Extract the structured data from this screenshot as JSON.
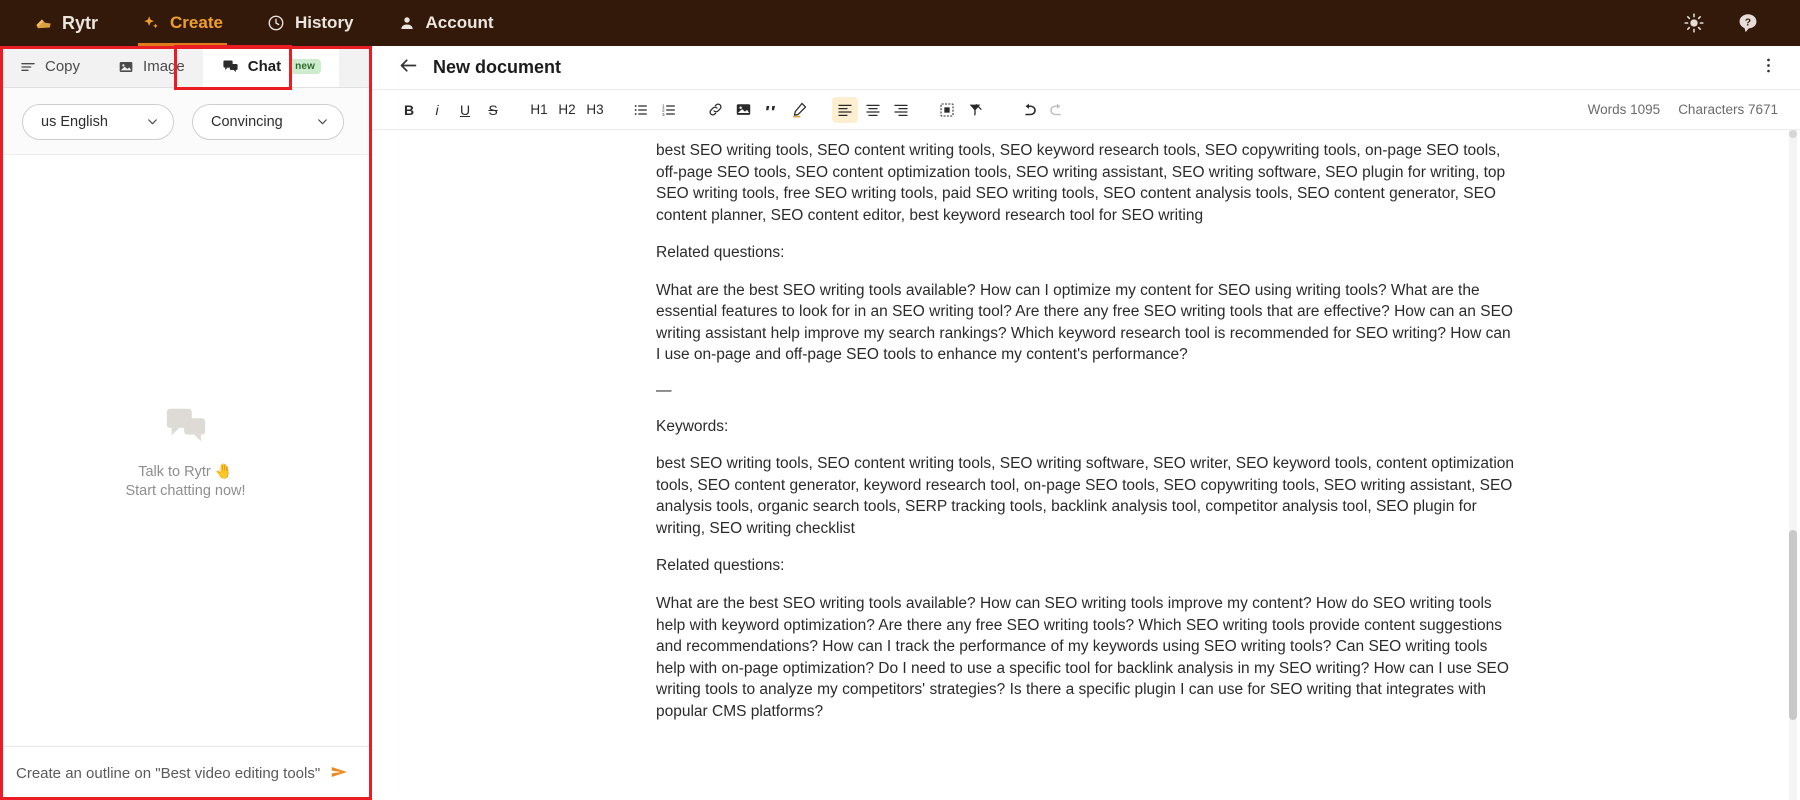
{
  "topnav": {
    "brand": "Rytr",
    "items": [
      {
        "label": "Rytr",
        "icon": "hand-wave-icon",
        "active": false
      },
      {
        "label": "Create",
        "icon": "sparkle-icon",
        "active": true
      },
      {
        "label": "History",
        "icon": "clock-icon",
        "active": false
      },
      {
        "label": "Account",
        "icon": "person-icon",
        "active": false
      }
    ],
    "right": [
      {
        "name": "brightness-icon"
      },
      {
        "name": "help-icon"
      }
    ]
  },
  "left_panel": {
    "tabs": [
      {
        "label": "Copy",
        "icon": "lines-icon",
        "active": false,
        "badge": ""
      },
      {
        "label": "Image",
        "icon": "image-icon",
        "active": false,
        "badge": ""
      },
      {
        "label": "Chat",
        "icon": "chat-bubble-icon",
        "active": true,
        "badge": "new"
      }
    ],
    "language_select": {
      "value": "us English",
      "chevron": "⌄"
    },
    "tone_select": {
      "value": "Convincing",
      "chevron": "⌄"
    },
    "empty_state": {
      "icon": "chat-bubble-icon",
      "line1": "Talk to Rytr 🤚",
      "line2": "Start chatting now!"
    },
    "input": {
      "value": "",
      "placeholder": "Create an outline on \"Best video editing tools\"",
      "send_icon": "send-arrow-icon"
    }
  },
  "editor": {
    "back_icon": "back-arrow-icon",
    "title": "New document",
    "menu_icon": "kebab-menu-icon",
    "toolbar": [
      {
        "name": "bold-button",
        "glyph": "B",
        "style": "bold",
        "active": false
      },
      {
        "name": "italic-button",
        "glyph": "i",
        "style": "italic",
        "active": false
      },
      {
        "name": "underline-button",
        "glyph": "U",
        "style": "underline",
        "active": false
      },
      {
        "name": "strikethrough-button",
        "glyph": "S",
        "style": "strike",
        "active": false
      },
      {
        "name": "heading-1-button",
        "glyph": "H1",
        "style": "heading",
        "active": false
      },
      {
        "name": "heading-2-button",
        "glyph": "H2",
        "style": "heading",
        "active": false
      },
      {
        "name": "heading-3-button",
        "glyph": "H3",
        "style": "heading",
        "active": false
      },
      {
        "name": "bullet-list-button",
        "glyph": "☰",
        "style": "icon",
        "active": false
      },
      {
        "name": "numbered-list-button",
        "glyph": "☰",
        "style": "icon",
        "active": false
      },
      {
        "name": "link-button",
        "glyph": "🔗",
        "style": "icon",
        "active": false
      },
      {
        "name": "image-button",
        "glyph": "▣",
        "style": "icon",
        "active": false
      },
      {
        "name": "quote-button",
        "glyph": "”",
        "style": "icon",
        "active": false
      },
      {
        "name": "highlighter-button",
        "glyph": "✎",
        "style": "icon",
        "active": false
      },
      {
        "name": "align-left-button",
        "glyph": "≡",
        "style": "icon",
        "active": true
      },
      {
        "name": "align-center-button",
        "glyph": "≡",
        "style": "icon",
        "active": false
      },
      {
        "name": "align-right-button",
        "glyph": "≡",
        "style": "icon",
        "active": false
      },
      {
        "name": "insert-block-button",
        "glyph": "⬚",
        "style": "icon",
        "active": false
      },
      {
        "name": "clear-format-button",
        "glyph": "✗",
        "style": "icon",
        "active": false
      },
      {
        "name": "undo-button",
        "glyph": "↶",
        "style": "icon",
        "active": false
      },
      {
        "name": "redo-button",
        "glyph": "↷",
        "style": "icon",
        "active": false,
        "disabled": true
      }
    ],
    "counts": {
      "words_label": "Words 1095",
      "characters_label": "Characters 7671"
    },
    "content": [
      {
        "type": "paragraph",
        "text": "best SEO writing tools, SEO content writing tools, SEO keyword research tools, SEO copywriting tools, on-page SEO tools, off-page SEO tools, SEO content optimization tools, SEO writing assistant, SEO writing software, SEO plugin for writing, top SEO writing tools, free SEO writing tools, paid SEO writing tools, SEO content analysis tools, SEO content generator, SEO content planner, SEO content editor, best keyword research tool for SEO writing"
      },
      {
        "type": "paragraph",
        "text": "Related questions:"
      },
      {
        "type": "paragraph",
        "text": "What are the best SEO writing tools available? How can I optimize my content for SEO using writing tools? What are the essential features to look for in an SEO writing tool? Are there any free SEO writing tools that are effective? How can an SEO writing assistant help improve my search rankings? Which keyword research tool is recommended for SEO writing? How can I use on-page and off-page SEO tools to enhance my content's performance?"
      },
      {
        "type": "divider",
        "text": "—"
      },
      {
        "type": "paragraph",
        "text": "Keywords:"
      },
      {
        "type": "paragraph",
        "text": "best SEO writing tools, SEO content writing tools, SEO writing software, SEO writer, SEO keyword tools, content optimization tools, SEO content generator, keyword research tool, on-page SEO tools, SEO copywriting tools, SEO writing assistant, SEO analysis tools, organic search tools, SERP tracking tools, backlink analysis tool, competitor analysis tool, SEO plugin for writing, SEO writing checklist"
      },
      {
        "type": "paragraph",
        "text": "Related questions:"
      },
      {
        "type": "paragraph",
        "text": "What are the best SEO writing tools available? How can SEO writing tools improve my content? How do SEO writing tools help with keyword optimization? Are there any free SEO writing tools? Which SEO writing tools provide content suggestions and recommendations? How can I track the performance of my keywords using SEO writing tools? Can SEO writing tools help with on-page optimization? Do I need to use a specific tool for backlink analysis in my SEO writing? How can I use SEO writing tools to analyze my competitors' strategies? Is there a specific plugin I can use for SEO writing that integrates with popular CMS platforms?"
      }
    ]
  },
  "colors": {
    "topbar_bg": "#33190a",
    "accent": "#f0a028",
    "highlight": "#ea1c24",
    "badge_bg": "#cdeccd",
    "send": "#ee8b1f"
  }
}
